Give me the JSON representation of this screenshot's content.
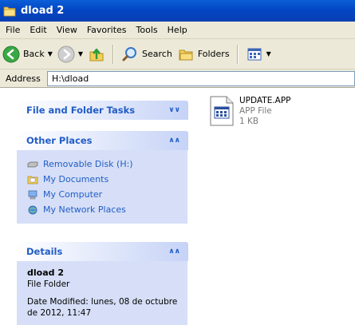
{
  "window": {
    "title": "dload 2"
  },
  "menu": [
    "File",
    "Edit",
    "View",
    "Favorites",
    "Tools",
    "Help"
  ],
  "toolbar": {
    "back_label": "Back",
    "search_label": "Search",
    "folders_label": "Folders"
  },
  "address": {
    "label": "Address",
    "value": "H:\\dload"
  },
  "panels": {
    "tasks": {
      "title": "File and Folder Tasks"
    },
    "other": {
      "title": "Other Places",
      "items": [
        "Removable Disk (H:)",
        "My Documents",
        "My Computer",
        "My Network Places"
      ]
    },
    "details": {
      "title": "Details",
      "name": "dload 2",
      "type": "File Folder",
      "modified": "Date Modified: lunes, 08 de octubre de 2012, 11:47"
    }
  },
  "files": [
    {
      "name": "UPDATE.APP",
      "type": "APP File",
      "size": "1 KB"
    }
  ],
  "icons": {
    "title": "folder-icon",
    "back": "back-arrow-icon",
    "forward": "forward-arrow-icon",
    "up": "up-folder-icon",
    "search": "search-icon",
    "folders": "folders-icon",
    "views": "views-icon"
  },
  "colors": {
    "titlebar": "#0346c4",
    "panel_bg": "#d6dff7",
    "link": "#215dc6"
  }
}
